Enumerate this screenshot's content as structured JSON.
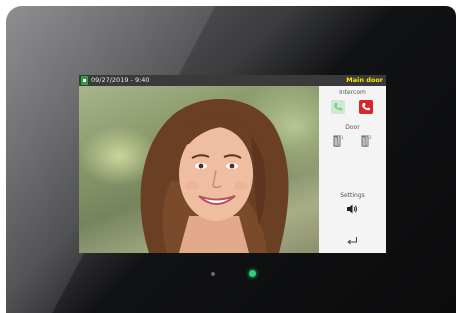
{
  "status_bar": {
    "datetime": "09/27/2019 - 9:40",
    "location": "Main door"
  },
  "panel": {
    "intercom_label": "Intercom",
    "door_label": "Door",
    "settings_label": "Settings"
  },
  "icons": {
    "status": "status-icon",
    "accept_call": "phone-icon",
    "hang_up": "hangup-icon",
    "door_1": "door-icon",
    "door_2": "door-icon",
    "volume": "speaker-icon",
    "back": "return-arrow-icon"
  },
  "colors": {
    "location_text": "#ffe400",
    "accept_call": "#bfe3c0",
    "hang_up": "#d7262a",
    "led_on": "#29d17a"
  }
}
